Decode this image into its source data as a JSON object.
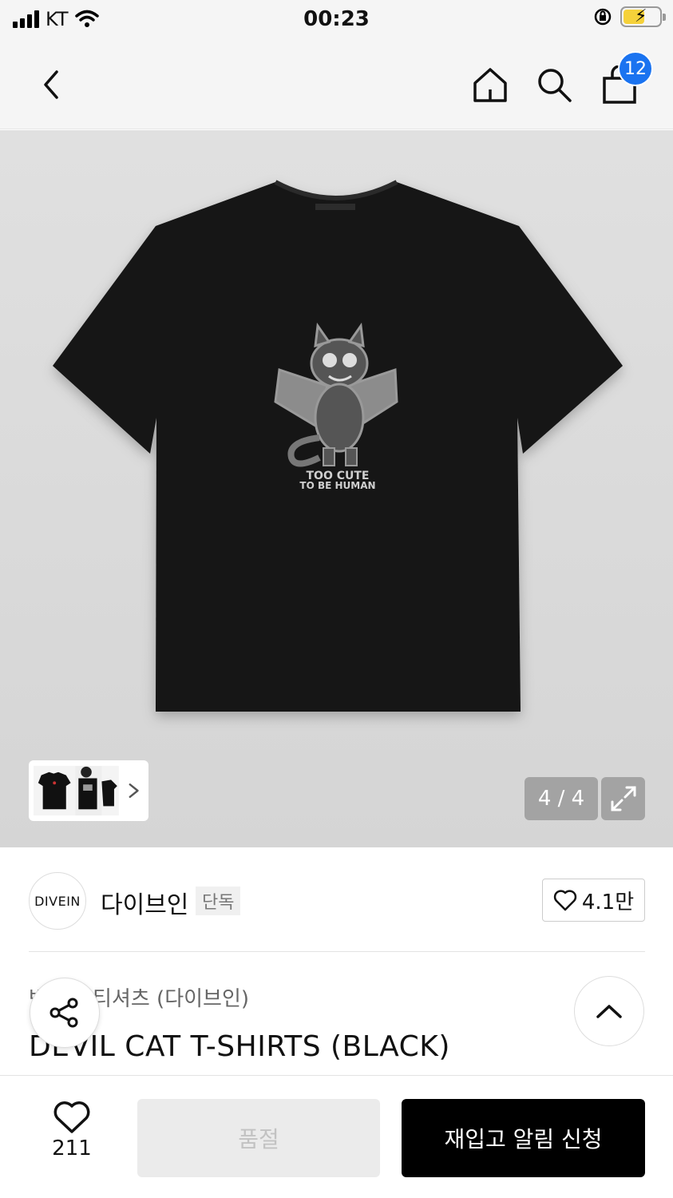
{
  "status_bar": {
    "carrier": "KT",
    "time": "00:23"
  },
  "header": {
    "cart_count": "12",
    "accent_color": "#1a73f0"
  },
  "hero": {
    "print_line1": "TOO CUTE",
    "print_line2": "TO BE HUMAN",
    "counter": "4 / 4"
  },
  "brand": {
    "logo_text": "DIVEIN",
    "name": "다이브인",
    "tag": "단독",
    "likes": "4.1만"
  },
  "product": {
    "category": "반소매 티셔츠 (다이브인)",
    "title": "DEVIL CAT T-SHIRTS (BLACK)"
  },
  "bottom_bar": {
    "wish_count": "211",
    "soldout_label": "품절",
    "restock_label": "재입고 알림 신청"
  },
  "icons": [
    "back-icon",
    "home-icon",
    "search-icon",
    "bag-icon",
    "expand-icon",
    "heart-icon",
    "share-icon",
    "chevron-up-icon",
    "chevron-right-icon",
    "wifi-icon",
    "battery-icon"
  ]
}
